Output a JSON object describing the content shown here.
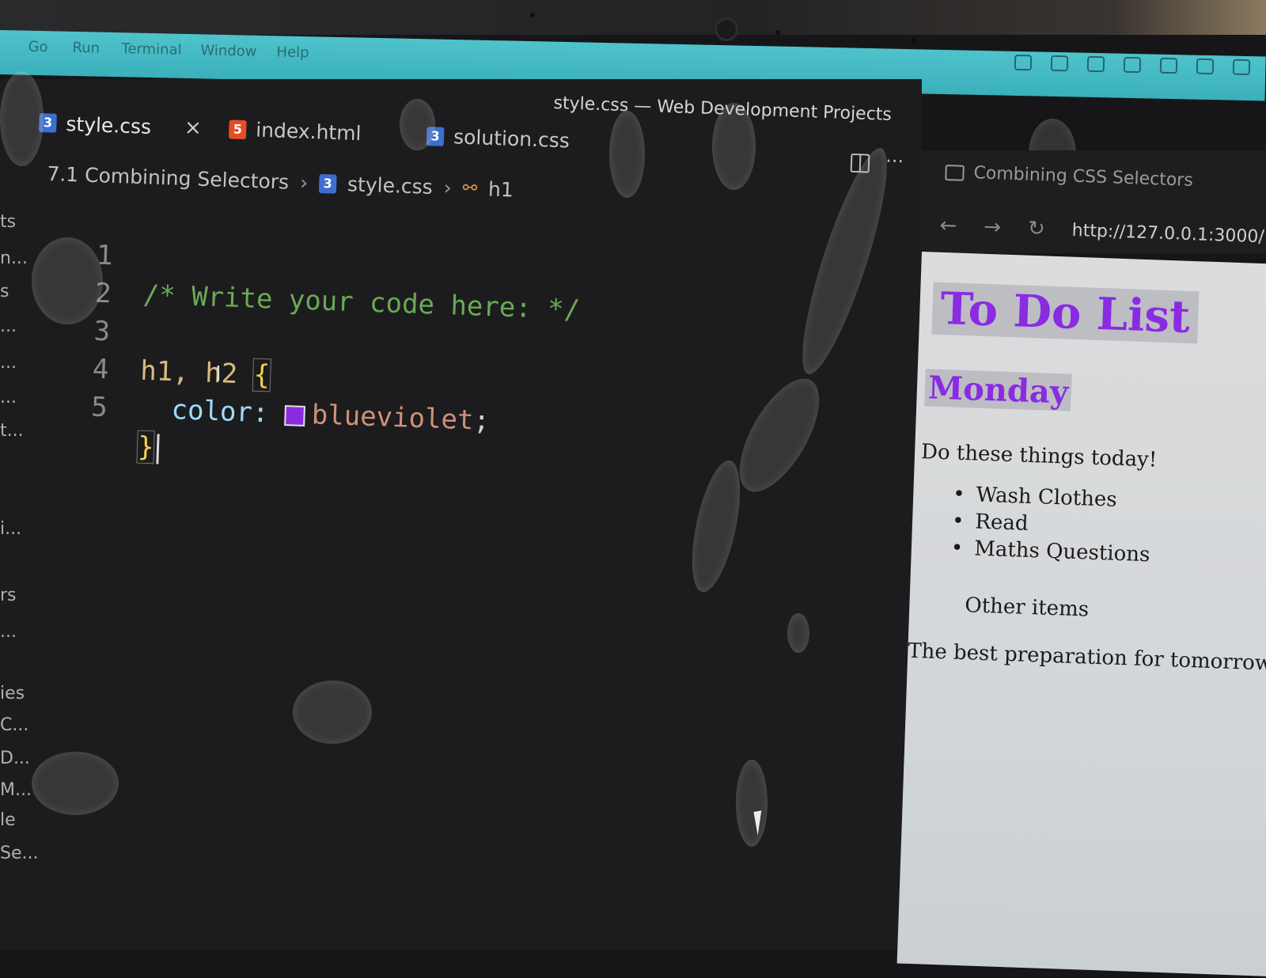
{
  "menu": {
    "items": [
      "Go",
      "Run",
      "Terminal",
      "Window",
      "Help"
    ]
  },
  "window_title": "style.css — Web Development Projects",
  "tabs": [
    {
      "label": "style.css",
      "type": "css"
    },
    {
      "label": "index.html",
      "type": "html"
    },
    {
      "label": "solution.css",
      "type": "css"
    }
  ],
  "breadcrumb": {
    "folder": "7.1 Combining Selectors",
    "file": "style.css",
    "symbol": "h1"
  },
  "editor": {
    "lines": [
      {
        "num": "1",
        "comment": "/* Write your code here: */"
      },
      {
        "num": "2"
      },
      {
        "num": "3",
        "selector": "h1, h2 ",
        "brace_open": "{"
      },
      {
        "num": "4",
        "property": "color: ",
        "value": "blueviolet",
        "semicolon": ";"
      },
      {
        "num": "5",
        "brace_close": "}"
      }
    ],
    "swatch_color": "#8a2be2"
  },
  "sidebar_fragments": [
    "ts",
    "n...",
    "s",
    "...",
    "...",
    "...",
    "t...",
    "i...",
    "rs",
    "...",
    "ies",
    "C...",
    "D...",
    "M...",
    "le",
    "Se..."
  ],
  "preview": {
    "tab_title": "Combining CSS Selectors",
    "url": "http://127.0.0.1:3000/",
    "page": {
      "h1": "To Do List",
      "h2": "Monday",
      "paragraph": "Do these things today!",
      "list": [
        "Wash Clothes",
        "Read",
        "Maths Questions"
      ],
      "other": "Other items",
      "quote": "The best preparation for tomorrow is do"
    }
  },
  "colors": {
    "heading": "#8a2be2",
    "accent_menu": "#3ab0bb"
  }
}
